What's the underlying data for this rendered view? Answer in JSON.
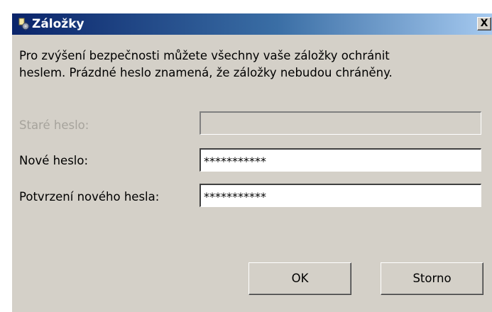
{
  "window": {
    "title": "Záložky",
    "close_label": "X"
  },
  "description": {
    "line1": "Pro zvýšení bezpečnosti můžete všechny vaše záložky ochránit",
    "line2": "heslem. Prázdné heslo znamená, že záložky nebudou chráněny."
  },
  "form": {
    "old_password": {
      "label": "Staré heslo:",
      "value": "",
      "enabled": false
    },
    "new_password": {
      "label": "Nové heslo:",
      "value": "***********"
    },
    "confirm_password": {
      "label": "Potvrzení nového hesla:",
      "value": "***********"
    }
  },
  "buttons": {
    "ok_label": "OK",
    "cancel_label": "Storno"
  },
  "colors": {
    "titlebar_start": "#0a246a",
    "titlebar_end": "#a6caf0",
    "dialog_background": "#d4d0c8",
    "disabled_text": "#a6a39c"
  },
  "icons": {
    "title_icon": "bookmarks-gear-icon",
    "close_icon": "close-icon"
  }
}
